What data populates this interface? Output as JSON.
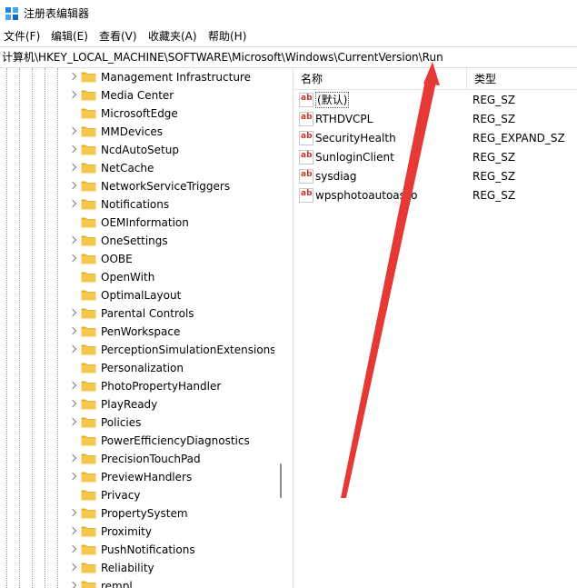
{
  "window": {
    "title": "注册表编辑器",
    "icon": "registry-icon"
  },
  "menu": [
    {
      "label": "文件(F)"
    },
    {
      "label": "编辑(E)"
    },
    {
      "label": "查看(V)"
    },
    {
      "label": "收藏夹(A)"
    },
    {
      "label": "帮助(H)"
    }
  ],
  "address": {
    "path": "计算机\\HKEY_LOCAL_MACHINE\\SOFTWARE\\Microsoft\\Windows\\CurrentVersion\\Run"
  },
  "tree": {
    "items": [
      {
        "label": "Management Infrastructure",
        "expandable": true
      },
      {
        "label": "Media Center",
        "expandable": true
      },
      {
        "label": "MicrosoftEdge",
        "expandable": false
      },
      {
        "label": "MMDevices",
        "expandable": true
      },
      {
        "label": "NcdAutoSetup",
        "expandable": true
      },
      {
        "label": "NetCache",
        "expandable": true
      },
      {
        "label": "NetworkServiceTriggers",
        "expandable": true
      },
      {
        "label": "Notifications",
        "expandable": true
      },
      {
        "label": "OEMInformation",
        "expandable": false
      },
      {
        "label": "OneSettings",
        "expandable": true
      },
      {
        "label": "OOBE",
        "expandable": true
      },
      {
        "label": "OpenWith",
        "expandable": false
      },
      {
        "label": "OptimalLayout",
        "expandable": false
      },
      {
        "label": "Parental Controls",
        "expandable": true
      },
      {
        "label": "PenWorkspace",
        "expandable": true
      },
      {
        "label": "PerceptionSimulationExtensions",
        "expandable": true
      },
      {
        "label": "Personalization",
        "expandable": false
      },
      {
        "label": "PhotoPropertyHandler",
        "expandable": true
      },
      {
        "label": "PlayReady",
        "expandable": true
      },
      {
        "label": "Policies",
        "expandable": true
      },
      {
        "label": "PowerEfficiencyDiagnostics",
        "expandable": false
      },
      {
        "label": "PrecisionTouchPad",
        "expandable": true
      },
      {
        "label": "PreviewHandlers",
        "expandable": true
      },
      {
        "label": "Privacy",
        "expandable": false
      },
      {
        "label": "PropertySystem",
        "expandable": true
      },
      {
        "label": "Proximity",
        "expandable": true
      },
      {
        "label": "PushNotifications",
        "expandable": true
      },
      {
        "label": "Reliability",
        "expandable": true
      },
      {
        "label": "rempl",
        "expandable": true
      }
    ]
  },
  "values": {
    "columns": {
      "name": "名称",
      "type": "类型"
    },
    "rows": [
      {
        "name": "(默认)",
        "type": "REG_SZ",
        "selected": true
      },
      {
        "name": "RTHDVCPL",
        "type": "REG_SZ",
        "selected": false
      },
      {
        "name": "SecurityHealth",
        "type": "REG_EXPAND_SZ",
        "selected": false
      },
      {
        "name": "SunloginClient",
        "type": "REG_SZ",
        "selected": false
      },
      {
        "name": "sysdiag",
        "type": "REG_SZ",
        "selected": false
      },
      {
        "name": "wpsphotoautoasso",
        "type": "REG_SZ",
        "selected": false
      }
    ],
    "value_icon": "string-value-icon",
    "value_icon_text": "ab"
  },
  "annotation": {
    "color": "#e53935"
  },
  "colors": {
    "folder": "#f5c84c",
    "folder_dark": "#e0a82e"
  }
}
